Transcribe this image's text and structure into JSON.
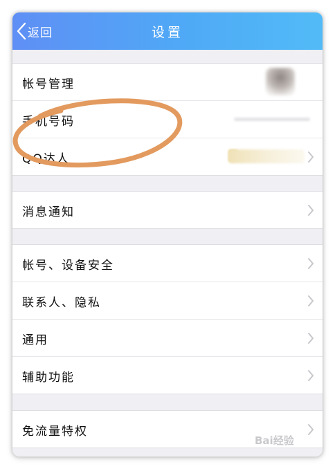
{
  "navbar": {
    "back_label": "返回",
    "title": "设置"
  },
  "groups": [
    {
      "rows": [
        {
          "label": "帐号管理"
        },
        {
          "label": "手机号码"
        },
        {
          "label": "QQ达人"
        }
      ]
    },
    {
      "rows": [
        {
          "label": "消息通知"
        }
      ]
    },
    {
      "rows": [
        {
          "label": "帐号、设备安全"
        },
        {
          "label": "联系人、隐私"
        },
        {
          "label": "通用"
        },
        {
          "label": "辅助功能"
        }
      ]
    },
    {
      "rows": [
        {
          "label": "免流量特权"
        }
      ]
    }
  ],
  "watermark": {
    "text": "Bai经验"
  },
  "colors": {
    "navbar_start": "#5f8ff5",
    "navbar_end": "#52bbf7",
    "annotation": "#e39a5e",
    "background": "#efeff4"
  }
}
